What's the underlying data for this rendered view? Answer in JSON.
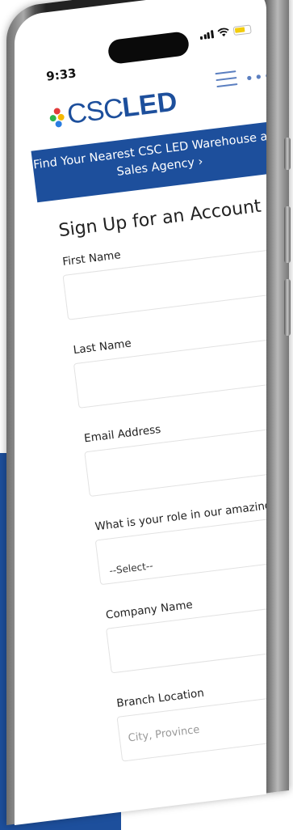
{
  "status_bar": {
    "time": "9:33"
  },
  "brand": {
    "name_light": "CSC",
    "name_bold": "LED",
    "primary_color": "#1d4f9c",
    "dot_colors": [
      "#e23b3b",
      "#2db34a",
      "#2a7de1",
      "#f5b700"
    ]
  },
  "nav": {
    "menu_icon": "hamburger-icon",
    "more_icon": "more-dots-icon"
  },
  "banner": {
    "text": "Find Your Nearest CSC LED Warehouse and Sales Agency ›"
  },
  "form": {
    "title": "Sign Up for an Account",
    "fields": [
      {
        "label": "First Name",
        "value": "",
        "placeholder": ""
      },
      {
        "label": "Last Name",
        "value": "",
        "placeholder": ""
      },
      {
        "label": "Email Address",
        "value": "",
        "placeholder": ""
      },
      {
        "label": "What is your role in our amazing industry?",
        "selected": "--Select--"
      },
      {
        "label": "Company Name",
        "value": "",
        "placeholder": ""
      },
      {
        "label": "Branch Location",
        "value": "",
        "placeholder": "City, Province"
      }
    ]
  }
}
